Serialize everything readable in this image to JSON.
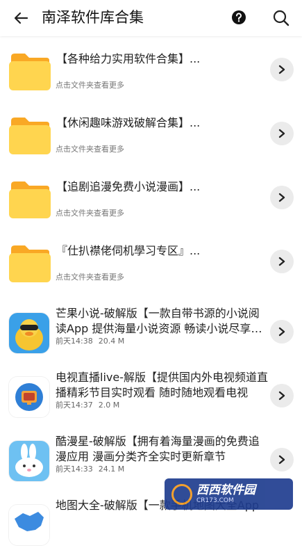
{
  "header": {
    "title": "南泽软件库合集"
  },
  "folders": [
    {
      "title": "【各种给力实用软件合集】...",
      "subtitle": "点击文件夹查看更多"
    },
    {
      "title": "【休闲趣味游戏破解合集】...",
      "subtitle": "点击文件夹查看更多"
    },
    {
      "title": "【追剧追漫免费小说漫画】...",
      "subtitle": "点击文件夹查看更多"
    },
    {
      "title": "『仕扒襟佬伺机學习专区』...",
      "subtitle": "点击文件夹查看更多"
    }
  ],
  "apps": [
    {
      "title": "芒果小说-破解版【一款自带书源的小说阅读App 提供海量小说资源 畅读小说尽享全网",
      "time": "前天14:38",
      "size": "20.4 M"
    },
    {
      "title": "电视直播live-解版【提供国内外电视频道直播精彩节目实时观看 随时随地观看电视",
      "time": "前天14:37",
      "size": "2.0 M"
    },
    {
      "title": "酷漫星-破解版【拥有着海量漫画的免费追漫应用 漫画分类齐全实时更新章节",
      "time": "前天14:33",
      "size": "24.1 M"
    },
    {
      "title": "地图大全-破解版【一款手机地图大全App",
      "time": "",
      "size": ""
    }
  ],
  "watermark": {
    "main": "西西软件园",
    "sub": "CR173.COM"
  },
  "colors": {
    "folder_yellow": "#FFD54F",
    "folder_tab": "#F9A825",
    "chevron_bg": "#EBEBEB",
    "watermark_bg": "#1F3D8F"
  }
}
